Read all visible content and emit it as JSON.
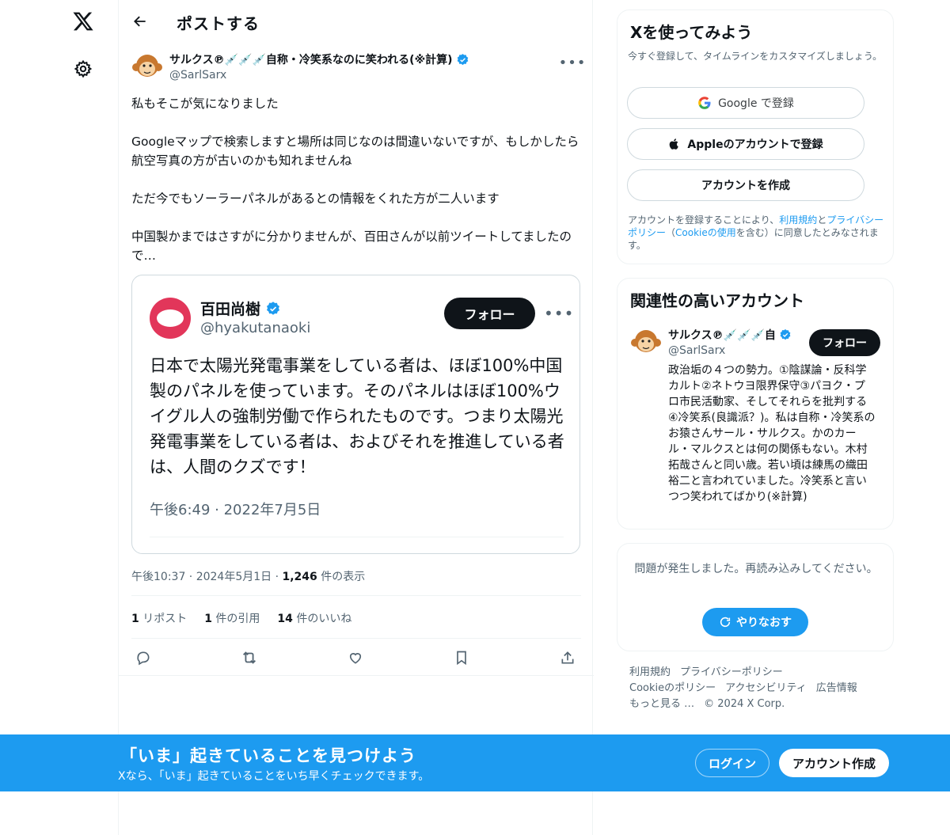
{
  "header": {
    "title": "ポストする"
  },
  "post": {
    "author_name": "サルクス℗💉💉💉自称・冷笑系なのに笑われる(※計算)",
    "author_handle": "@SarlSarx",
    "paragraphs": [
      "私もそこが気になりました",
      "Googleマップで検索しますと場所は同じなのは間違いないですが、もしかしたら航空写真の方が古いのかも知れませんね",
      "ただ今でもソーラーパネルがあるとの情報をくれた方が二人います",
      "中国製かまではさすがに分かりませんが、百田さんが以前ツイートしてましたので…"
    ],
    "time": "午後10:37 · 2024年5月1日 · ",
    "views_count": "1,246",
    "views_label": " 件の表示",
    "reposts_count": "1",
    "reposts_label": " リポスト",
    "quotes_count": "1",
    "quotes_label": " 件の引用",
    "likes_count": "14",
    "likes_label": " 件のいいね"
  },
  "quote": {
    "name": "百田尚樹",
    "handle": "@hyakutanaoki",
    "follow_label": "フォロー",
    "text": "日本で太陽光発電事業をしている者は、ほぼ100%中国製のパネルを使っています。そのパネルはほぼ100%ウイグル人の強制労働で作られたものです。つまり太陽光発電事業をしている者は、およびそれを推進している者は、人間のクズです！",
    "time": "午後6:49 · 2022年7月5日"
  },
  "signup_card": {
    "title": "Xを使ってみよう",
    "subtitle": "今すぐ登録して、タイムラインをカスタマイズしましょう。",
    "google_label": "Google で登録",
    "apple_label": "Appleのアカウントで登録",
    "create_label": "アカウントを作成",
    "terms_prefix": "アカウントを登録することにより、",
    "terms_link": "利用規約",
    "terms_and": "と",
    "privacy_link": "プライバシーポリシー",
    "terms_paren_open": "（",
    "cookie_link": "Cookieの使用",
    "terms_suffix": "を含む）に同意したとみなされます。"
  },
  "related": {
    "title": "関連性の高いアカウント",
    "name": "サルクス℗💉💉💉自",
    "handle": "@SarlSarx",
    "follow_label": "フォロー",
    "bio": "政治垢の４つの勢力。①陰謀論・反科学カルト②ネトウヨ限界保守③パヨク・プロ市民活動家、そしてそれらを批判する④冷笑系(良識派？)。私は自称・冷笑系のお猿さんサール・サルクス。かのカール・マルクスとは何の関係もない。木村拓哉さんと同い歳。若い頃は練馬の織田裕二と言われていました。冷笑系と言いつつ笑われてばかり(※計算)"
  },
  "error_card": {
    "message": "問題が発生しました。再読み込みしてください。",
    "retry_label": "やりなおす"
  },
  "footer": {
    "terms": "利用規約",
    "privacy": "プライバシーポリシー",
    "cookie": "Cookieのポリシー",
    "accessibility": "アクセシビリティ",
    "ads": "広告情報",
    "more": "もっと見る …",
    "copyright": "© 2024 X Corp."
  },
  "banner": {
    "title": "「いま」起きていることを見つけよう",
    "subtitle": "Xなら、「いま」起きていることをいち早くチェックできます。",
    "login_label": "ログイン",
    "signup_label": "アカウント作成"
  },
  "colors": {
    "accent": "#1d9bf0",
    "text": "#0f1419",
    "muted": "#536471",
    "border": "#eff3f4"
  },
  "icons": [
    "x-logo-icon",
    "gear-icon",
    "back-arrow-icon",
    "verified-badge-icon",
    "more-icon",
    "reply-icon",
    "repost-icon",
    "like-icon",
    "bookmark-icon",
    "share-icon",
    "google-icon",
    "apple-icon",
    "refresh-icon"
  ]
}
